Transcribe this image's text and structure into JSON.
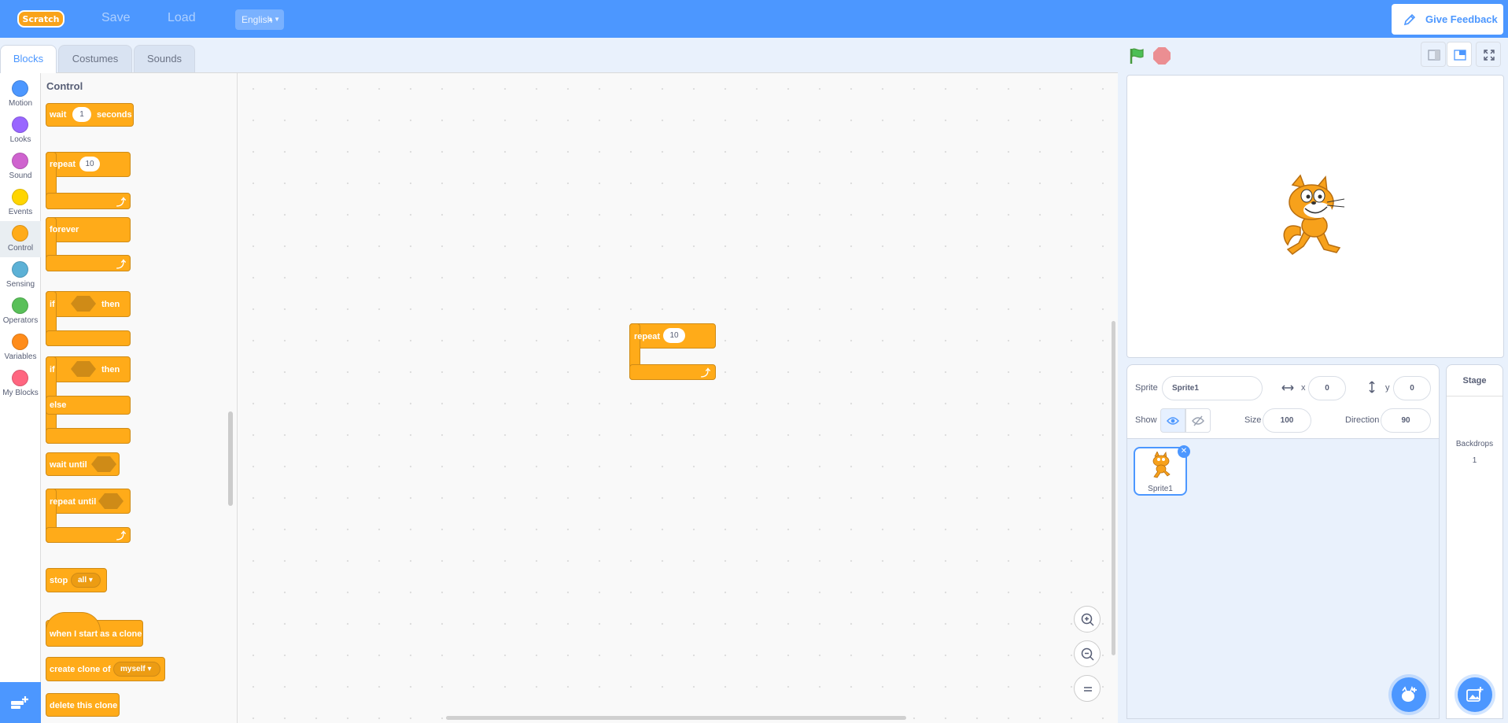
{
  "menubar": {
    "logo_text": "Scratch",
    "save_label": "Save",
    "load_label": "Load",
    "language": "English",
    "feedback_label": "Give Feedback"
  },
  "tabs": [
    {
      "label": "Blocks",
      "active": true
    },
    {
      "label": "Costumes",
      "active": false
    },
    {
      "label": "Sounds",
      "active": false
    }
  ],
  "categories": [
    {
      "label": "Motion",
      "color": "#4c97ff"
    },
    {
      "label": "Looks",
      "color": "#9966ff"
    },
    {
      "label": "Sound",
      "color": "#cf63cf"
    },
    {
      "label": "Events",
      "color": "#ffd500"
    },
    {
      "label": "Control",
      "color": "#ffab19",
      "active": true
    },
    {
      "label": "Sensing",
      "color": "#5cb1d6"
    },
    {
      "label": "Operators",
      "color": "#59c059"
    },
    {
      "label": "Variables",
      "color": "#ff8c1a"
    },
    {
      "label": "My Blocks",
      "color": "#ff6680"
    }
  ],
  "flyout": {
    "title": "Control",
    "wait": {
      "label": "wait",
      "value": "1",
      "unit": "seconds"
    },
    "repeat": {
      "label": "repeat",
      "value": "10"
    },
    "forever": {
      "label": "forever"
    },
    "if_then": {
      "if": "if",
      "then": "then"
    },
    "if_else": {
      "if": "if",
      "then": "then",
      "else": "else"
    },
    "wait_until": {
      "label": "wait until"
    },
    "repeat_until": {
      "label": "repeat until"
    },
    "stop": {
      "label": "stop",
      "option": "all"
    },
    "clone_start": {
      "label": "when I start as a clone"
    },
    "create_clone": {
      "label": "create clone of",
      "option": "myself"
    },
    "delete_clone": {
      "label": "delete this clone"
    }
  },
  "workspace": {
    "block": {
      "label": "repeat",
      "value": "10"
    }
  },
  "sprite_info": {
    "sprite_label": "Sprite",
    "sprite_name": "Sprite1",
    "x_label": "x",
    "x_value": "0",
    "y_label": "y",
    "y_value": "0",
    "show_label": "Show",
    "size_label": "Size",
    "size_value": "100",
    "direction_label": "Direction",
    "direction_value": "90"
  },
  "sprites": [
    {
      "name": "Sprite1",
      "selected": true
    }
  ],
  "stage_pane": {
    "title": "Stage",
    "backdrops_label": "Backdrops",
    "backdrops_count": "1"
  }
}
